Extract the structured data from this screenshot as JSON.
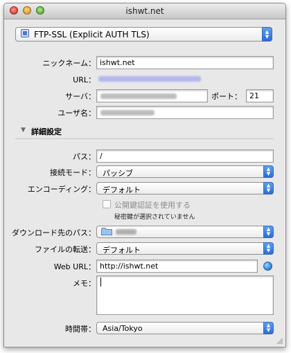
{
  "window": {
    "title": "ishwt.net"
  },
  "protocol": {
    "value": "FTP-SSL (Explicit AUTH TLS)"
  },
  "labels": {
    "nickname": "ニックネーム：",
    "url": "URL：",
    "server": "サーバ：",
    "port": "ポート：",
    "username": "ユーザ名：",
    "path": "パス：",
    "connect_mode": "接続モード：",
    "encoding": "エンコーディング：",
    "download_path": "ダウンロード先のパス：",
    "file_transfer": "ファイルの転送：",
    "web_url": "Web URL：",
    "memo": "メモ：",
    "timezone": "時間帯："
  },
  "fields": {
    "nickname": "ishwt.net",
    "port": "21",
    "path": "/",
    "web_url": "http://ishwt.net",
    "memo": ""
  },
  "advanced": {
    "title": "詳細設定"
  },
  "selects": {
    "connect_mode": "パッシブ",
    "encoding": "デフォルト",
    "file_transfer": "デフォルト",
    "timezone": "Asia/Tokyo"
  },
  "public_key": {
    "checkbox_label": "公開鍵認証を使用する",
    "status": "秘密鍵が選択されていません"
  },
  "colors": {
    "popup_arrow": "#2c6bd6",
    "link_blurred": "#8a8ff0"
  },
  "icons": [
    "ftp-lock-icon",
    "disclosure-triangle-icon",
    "folder-icon",
    "globe-icon",
    "resize-grip-icon"
  ]
}
